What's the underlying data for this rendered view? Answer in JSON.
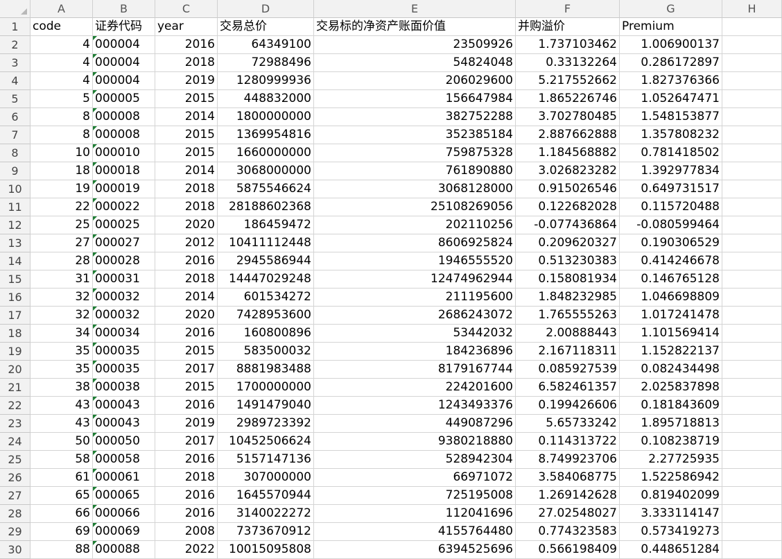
{
  "sheet": {
    "column_letters": [
      "A",
      "B",
      "C",
      "D",
      "E",
      "F",
      "G",
      "H"
    ],
    "headers": [
      "code",
      "证券代码",
      "year",
      "交易总价",
      "交易标的净资产账面价值",
      "并购溢价",
      "Premium",
      ""
    ],
    "rows": [
      {
        "n": "2",
        "code": "4",
        "sec": "000004",
        "year": "2016",
        "total": "64349100",
        "nav": "23509926",
        "prem_cn": "1.737103462",
        "premium": "1.006900137"
      },
      {
        "n": "3",
        "code": "4",
        "sec": "000004",
        "year": "2018",
        "total": "72988496",
        "nav": "54824048",
        "prem_cn": "0.33132264",
        "premium": "0.286172897"
      },
      {
        "n": "4",
        "code": "4",
        "sec": "000004",
        "year": "2019",
        "total": "1280999936",
        "nav": "206029600",
        "prem_cn": "5.217552662",
        "premium": "1.827376366"
      },
      {
        "n": "5",
        "code": "5",
        "sec": "000005",
        "year": "2015",
        "total": "448832000",
        "nav": "156647984",
        "prem_cn": "1.865226746",
        "premium": "1.052647471"
      },
      {
        "n": "6",
        "code": "8",
        "sec": "000008",
        "year": "2014",
        "total": "1800000000",
        "nav": "382752288",
        "prem_cn": "3.702780485",
        "premium": "1.548153877"
      },
      {
        "n": "7",
        "code": "8",
        "sec": "000008",
        "year": "2015",
        "total": "1369954816",
        "nav": "352385184",
        "prem_cn": "2.887662888",
        "premium": "1.357808232"
      },
      {
        "n": "8",
        "code": "10",
        "sec": "000010",
        "year": "2015",
        "total": "1660000000",
        "nav": "759875328",
        "prem_cn": "1.184568882",
        "premium": "0.781418502"
      },
      {
        "n": "9",
        "code": "18",
        "sec": "000018",
        "year": "2014",
        "total": "3068000000",
        "nav": "761890880",
        "prem_cn": "3.026823282",
        "premium": "1.392977834"
      },
      {
        "n": "10",
        "code": "19",
        "sec": "000019",
        "year": "2018",
        "total": "5875546624",
        "nav": "3068128000",
        "prem_cn": "0.915026546",
        "premium": "0.649731517"
      },
      {
        "n": "11",
        "code": "22",
        "sec": "000022",
        "year": "2018",
        "total": "28188602368",
        "nav": "25108269056",
        "prem_cn": "0.122682028",
        "premium": "0.115720488"
      },
      {
        "n": "12",
        "code": "25",
        "sec": "000025",
        "year": "2020",
        "total": "186459472",
        "nav": "202110256",
        "prem_cn": "-0.077436864",
        "premium": "-0.080599464"
      },
      {
        "n": "13",
        "code": "27",
        "sec": "000027",
        "year": "2012",
        "total": "10411112448",
        "nav": "8606925824",
        "prem_cn": "0.209620327",
        "premium": "0.190306529"
      },
      {
        "n": "14",
        "code": "28",
        "sec": "000028",
        "year": "2016",
        "total": "2945586944",
        "nav": "1946555520",
        "prem_cn": "0.513230383",
        "premium": "0.414246678"
      },
      {
        "n": "15",
        "code": "31",
        "sec": "000031",
        "year": "2018",
        "total": "14447029248",
        "nav": "12474962944",
        "prem_cn": "0.158081934",
        "premium": "0.146765128"
      },
      {
        "n": "16",
        "code": "32",
        "sec": "000032",
        "year": "2014",
        "total": "601534272",
        "nav": "211195600",
        "prem_cn": "1.848232985",
        "premium": "1.046698809"
      },
      {
        "n": "17",
        "code": "32",
        "sec": "000032",
        "year": "2020",
        "total": "7428953600",
        "nav": "2686243072",
        "prem_cn": "1.765555263",
        "premium": "1.017241478"
      },
      {
        "n": "18",
        "code": "34",
        "sec": "000034",
        "year": "2016",
        "total": "160800896",
        "nav": "53442032",
        "prem_cn": "2.00888443",
        "premium": "1.101569414"
      },
      {
        "n": "19",
        "code": "35",
        "sec": "000035",
        "year": "2015",
        "total": "583500032",
        "nav": "184236896",
        "prem_cn": "2.167118311",
        "premium": "1.152822137"
      },
      {
        "n": "20",
        "code": "35",
        "sec": "000035",
        "year": "2017",
        "total": "8881983488",
        "nav": "8179167744",
        "prem_cn": "0.085927539",
        "premium": "0.082434498"
      },
      {
        "n": "21",
        "code": "38",
        "sec": "000038",
        "year": "2015",
        "total": "1700000000",
        "nav": "224201600",
        "prem_cn": "6.582461357",
        "premium": "2.025837898"
      },
      {
        "n": "22",
        "code": "43",
        "sec": "000043",
        "year": "2016",
        "total": "1491479040",
        "nav": "1243493376",
        "prem_cn": "0.199426606",
        "premium": "0.181843609"
      },
      {
        "n": "23",
        "code": "43",
        "sec": "000043",
        "year": "2019",
        "total": "2989723392",
        "nav": "449087296",
        "prem_cn": "5.65733242",
        "premium": "1.895718813"
      },
      {
        "n": "24",
        "code": "50",
        "sec": "000050",
        "year": "2017",
        "total": "10452506624",
        "nav": "9380218880",
        "prem_cn": "0.114313722",
        "premium": "0.108238719"
      },
      {
        "n": "25",
        "code": "58",
        "sec": "000058",
        "year": "2016",
        "total": "5157147136",
        "nav": "528942304",
        "prem_cn": "8.749923706",
        "premium": "2.27725935"
      },
      {
        "n": "26",
        "code": "61",
        "sec": "000061",
        "year": "2018",
        "total": "307000000",
        "nav": "66971072",
        "prem_cn": "3.584068775",
        "premium": "1.522586942"
      },
      {
        "n": "27",
        "code": "65",
        "sec": "000065",
        "year": "2016",
        "total": "1645570944",
        "nav": "725195008",
        "prem_cn": "1.269142628",
        "premium": "0.819402099"
      },
      {
        "n": "28",
        "code": "66",
        "sec": "000066",
        "year": "2016",
        "total": "3140022272",
        "nav": "112041696",
        "prem_cn": "27.02548027",
        "premium": "3.333114147"
      },
      {
        "n": "29",
        "code": "69",
        "sec": "000069",
        "year": "2008",
        "total": "7373670912",
        "nav": "4155764480",
        "prem_cn": "0.774323583",
        "premium": "0.573419273"
      },
      {
        "n": "30",
        "code": "88",
        "sec": "000088",
        "year": "2022",
        "total": "10015095808",
        "nav": "6394525696",
        "prem_cn": "0.566198409",
        "premium": "0.448651284"
      }
    ]
  },
  "colors": {
    "header_bg": "#f2f2f2",
    "gridline": "#d4d4d4",
    "text_flag": "#1e7e34"
  }
}
